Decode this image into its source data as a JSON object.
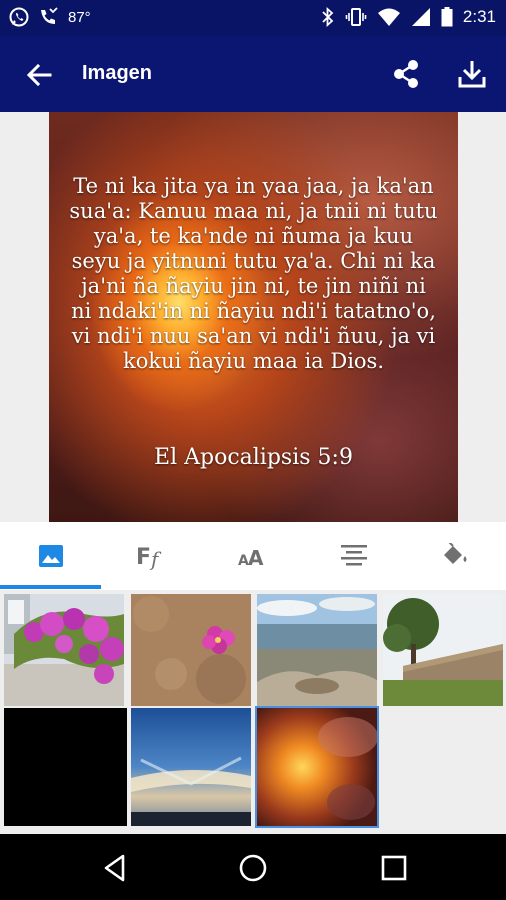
{
  "status_bar": {
    "temperature": "87°",
    "time": "2:31",
    "icons": [
      "whatsapp-icon",
      "missed-call-icon",
      "bluetooth-icon",
      "vibrate-icon",
      "wifi-icon",
      "signal-icon",
      "battery-icon"
    ]
  },
  "app_bar": {
    "title": "Imagen",
    "icons": [
      "back-arrow-icon",
      "share-icon",
      "download-icon"
    ],
    "background": "#0b1672"
  },
  "preview": {
    "verse": "Te ni ka jita ya in yaa jaa, ja ka'an sua'a: Kanuu maa ni, ja tnii ni tutu ya'a, te ka'nde ni ñuma ja kuu seyu ja yitnuni tutu ya'a. Chi ni ka ja'ni ña ñayiu jin ni, te jin niñi ni ni ndaki'in ni ñayiu ndi'i tatatno'o, vi ndi'i nuu sa'an vi ndi'i ñuu, ja vi kokui ñayiu maa ia Dios.",
    "reference": "El Apocalipsis 5:9"
  },
  "tabs": [
    {
      "name": "background-image",
      "icon": "image-icon",
      "selected": true
    },
    {
      "name": "font",
      "icon": "font-family-icon",
      "selected": false
    },
    {
      "name": "text-size",
      "icon": "text-size-icon",
      "selected": false
    },
    {
      "name": "alignment",
      "icon": "align-center-icon",
      "selected": false
    },
    {
      "name": "color",
      "icon": "paint-bucket-icon",
      "selected": false
    }
  ],
  "accent_color": "#1e88e5",
  "gallery": {
    "thumbnails": [
      {
        "name": "bougainvillea-flowers",
        "selected": false
      },
      {
        "name": "pink-flower-sand",
        "selected": false
      },
      {
        "name": "mountain-landscape",
        "selected": false
      },
      {
        "name": "tree-stone-wall",
        "selected": false
      },
      {
        "name": "black",
        "selected": false
      },
      {
        "name": "sunset-sky",
        "selected": false
      },
      {
        "name": "fiery-clouds",
        "selected": true
      }
    ]
  },
  "nav_bar": {
    "icons": [
      "back-triangle-icon",
      "home-circle-icon",
      "recents-square-icon"
    ]
  }
}
